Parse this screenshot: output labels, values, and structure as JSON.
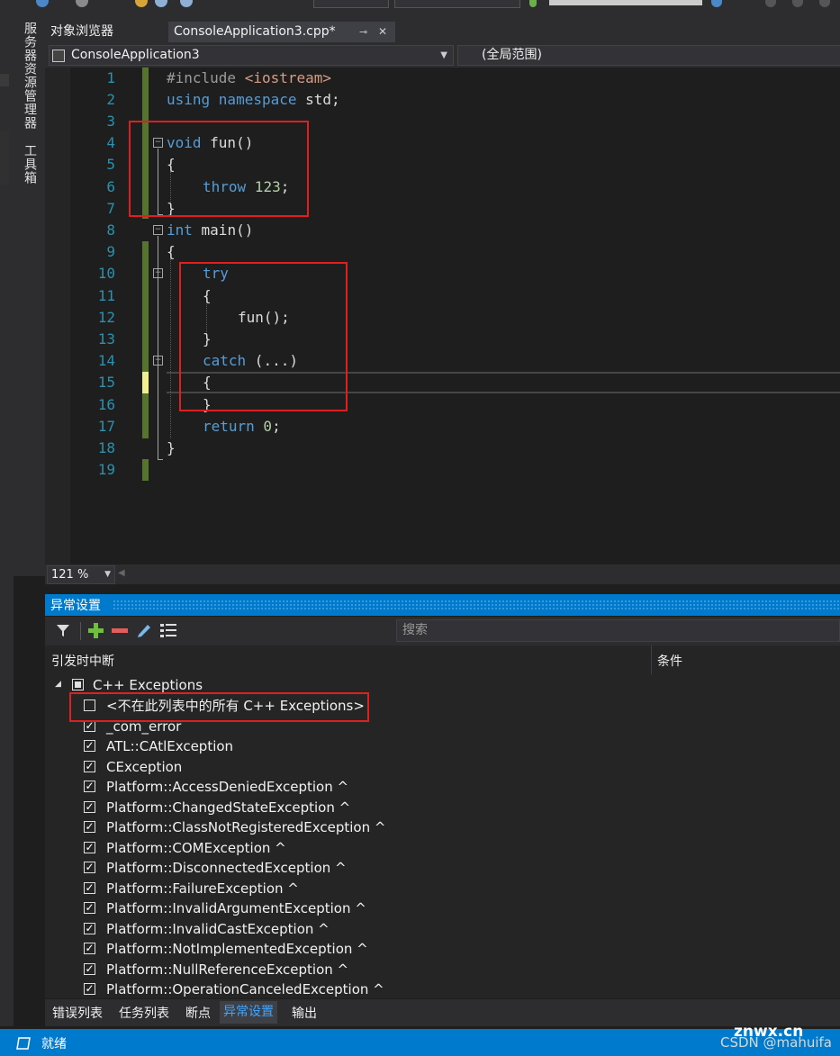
{
  "side_tabs": [
    "服务器资源管理器",
    "工具箱"
  ],
  "doc_tabs": {
    "tab1": "对象浏览器",
    "tab2": "ConsoleApplication3.cpp*",
    "pin": "⊸",
    "close": "✕"
  },
  "nav": {
    "project": "ConsoleApplication3",
    "scope": "(全局范围)"
  },
  "code": {
    "line_numbers": [
      "1",
      "2",
      "3",
      "4",
      "5",
      "6",
      "7",
      "8",
      "9",
      "10",
      "11",
      "12",
      "13",
      "14",
      "15",
      "16",
      "17",
      "18",
      "19"
    ],
    "l1_a": "#include ",
    "l1_b": "<iostream>",
    "l2_a": "using namespace",
    "l2_b": " std;",
    "l4_a": "void",
    "l4_b": " fun()",
    "l5": "{",
    "l6_a": "throw",
    "l6_b": " 123",
    "l6_c": ";",
    "l7": "}",
    "l8_a": "int",
    "l8_b": " main()",
    "l9": "{",
    "l10": "try",
    "l11": "{",
    "l12": "fun();",
    "l13": "}",
    "l14_a": "catch",
    "l14_b": " (...)",
    "l15": "{",
    "l16": "}",
    "l17_a": "return",
    "l17_b": " 0",
    "l17_c": ";",
    "l18": "}"
  },
  "zoom": "121 %",
  "panel": {
    "title": "异常设置",
    "search_placeholder": "搜索",
    "col_break": "引发时中断",
    "col_condition": "条件",
    "group": "C++ Exceptions",
    "items": [
      {
        "label": "<不在此列表中的所有 C++ Exceptions>",
        "checked": false
      },
      {
        "label": "_com_error",
        "checked": true
      },
      {
        "label": "ATL::CAtlException",
        "checked": true
      },
      {
        "label": "CException",
        "checked": true
      },
      {
        "label": "Platform::AccessDeniedException ^",
        "checked": true
      },
      {
        "label": "Platform::ChangedStateException ^",
        "checked": true
      },
      {
        "label": "Platform::ClassNotRegisteredException ^",
        "checked": true
      },
      {
        "label": "Platform::COMException ^",
        "checked": true
      },
      {
        "label": "Platform::DisconnectedException ^",
        "checked": true
      },
      {
        "label": "Platform::FailureException ^",
        "checked": true
      },
      {
        "label": "Platform::InvalidArgumentException ^",
        "checked": true
      },
      {
        "label": "Platform::InvalidCastException ^",
        "checked": true
      },
      {
        "label": "Platform::NotImplementedException ^",
        "checked": true
      },
      {
        "label": "Platform::NullReferenceException ^",
        "checked": true
      },
      {
        "label": "Platform::OperationCanceledException ^",
        "checked": true
      }
    ]
  },
  "bottom_tabs": [
    "错误列表",
    "任务列表",
    "断点",
    "异常设置",
    "输出"
  ],
  "status": "就绪",
  "watermark1": "znwx.cn",
  "watermark2": "CSDN @mahuifa",
  "colors": {
    "accent": "#007acc",
    "highlight_box": "#e02020",
    "keyword": "#569cd6"
  }
}
